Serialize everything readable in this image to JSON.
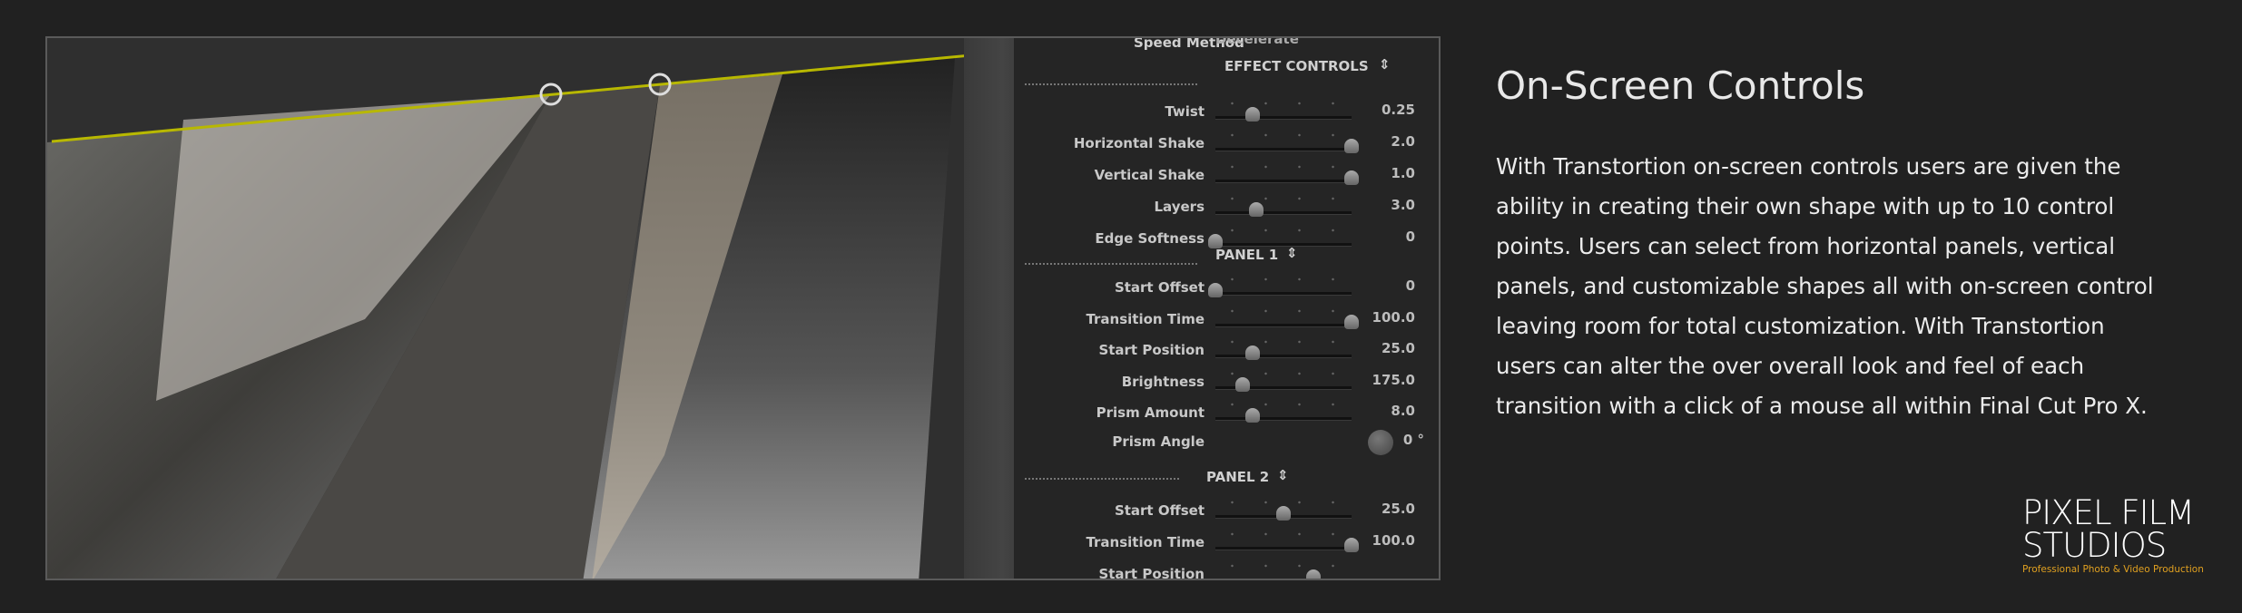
{
  "inspector": {
    "speed_method_label": "Speed Method",
    "speed_method_value": "Decelerate",
    "effect_controls": {
      "header": "EFFECT CONTROLS",
      "rows": [
        {
          "label": "Twist",
          "value": "0.25",
          "slider": 0.27
        },
        {
          "label": "Horizontal Shake",
          "value": "2.0",
          "slider": 1.0
        },
        {
          "label": "Vertical Shake",
          "value": "1.0",
          "slider": 1.0
        },
        {
          "label": "Layers",
          "value": "3.0",
          "slider": 0.3
        },
        {
          "label": "Edge Softness",
          "value": "0",
          "slider": 0.0
        }
      ]
    },
    "panel1": {
      "header": "PANEL 1",
      "rows": [
        {
          "label": "Start Offset",
          "value": "0",
          "slider": 0.0
        },
        {
          "label": "Transition Time",
          "value": "100.0",
          "slider": 1.0
        },
        {
          "label": "Start Position",
          "value": "25.0",
          "slider": 0.27
        },
        {
          "label": "Brightness",
          "value": "175.0",
          "slider": 0.2
        },
        {
          "label": "Prism Amount",
          "value": "8.0",
          "slider": 0.27
        }
      ],
      "prism_angle": {
        "label": "Prism Angle",
        "value": "0 °"
      }
    },
    "panel2": {
      "header": "PANEL 2",
      "rows": [
        {
          "label": "Start Offset",
          "value": "25.0",
          "slider": 0.5
        },
        {
          "label": "Transition Time",
          "value": "100.0",
          "slider": 1.0
        },
        {
          "label": "Start Position",
          "value": "",
          "slider": 0.72
        }
      ]
    }
  },
  "content": {
    "heading": "On-Screen Controls",
    "paragraph": "With Transtortion on-screen controls users are given the ability in creating their own shape with up to 10 control points. Users can select from horizontal panels, vertical panels, and customizable shapes all with on-screen control leaving room for total customization. With Transtortion users can alter the over overall look and feel of each transition with a click of a mouse all within Final Cut Pro X."
  },
  "logo": {
    "line1": "PIXEL FILM",
    "line2": "STUDIOS",
    "tagline": "Professional Photo & Video Production"
  },
  "colors": {
    "background": "#212121",
    "control_line": "#b8b800",
    "tagline": "#e0a020"
  }
}
